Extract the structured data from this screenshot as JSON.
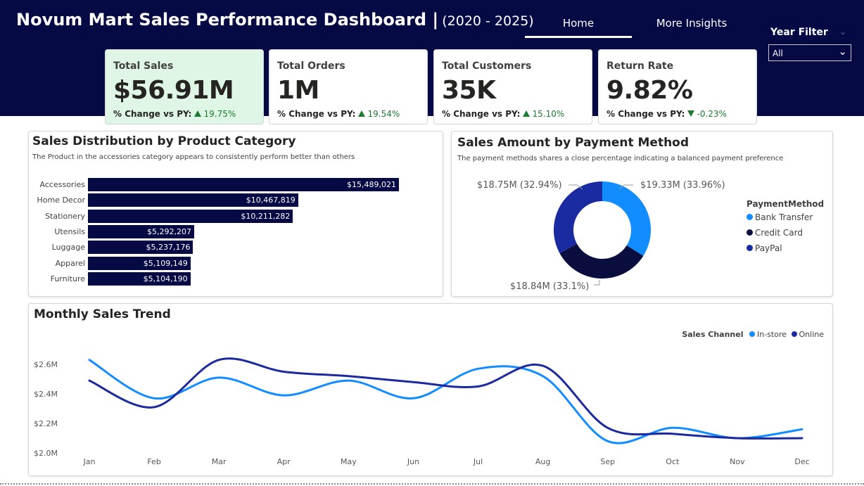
{
  "header": {
    "title": "Novum Mart Sales Performance Dashboard |",
    "subtitle": "(2020 - 2025)",
    "tabs": [
      {
        "label": "Home"
      },
      {
        "label": "More Insights"
      }
    ],
    "year_filter": {
      "label": "Year Filter",
      "value": "All"
    }
  },
  "kpis": [
    {
      "title": "Total Sales",
      "value": "$56.91M",
      "change_label": "% Change vs PY:",
      "change_value": "19.75%",
      "direction": "up"
    },
    {
      "title": "Total Orders",
      "value": "1M",
      "change_label": "% Change vs PY:",
      "change_value": "19.54%",
      "direction": "up"
    },
    {
      "title": "Total Customers",
      "value": "35K",
      "change_label": "% Change vs PY:",
      "change_value": "15.10%",
      "direction": "up"
    },
    {
      "title": "Return Rate",
      "value": "9.82%",
      "change_label": "% Change vs PY:",
      "change_value": "-0.23%",
      "direction": "down"
    }
  ],
  "category_panel": {
    "title": "Sales Distribution by Product Category",
    "subtitle": "The Product in the accessories category appears to consistently perform better than others"
  },
  "payment_panel": {
    "title": "Sales Amount by Payment Method",
    "subtitle": "The payment methods shares a close percentage indicating a balanced payment preference",
    "legend_title": "PaymentMethod"
  },
  "trend_panel": {
    "title": "Monthly Sales Trend",
    "legend_title": "Sales Channel"
  },
  "colors": {
    "navy": "#050a45",
    "light_blue": "#118dff",
    "dark_navy": "#0a0e3f",
    "royal_blue": "#1a2aa0",
    "online_line": "#1c2a9e",
    "green": "#1b7a30"
  },
  "chart_data": [
    {
      "type": "bar",
      "orientation": "horizontal",
      "title": "Sales Distribution by Product Category",
      "categories": [
        "Accessories",
        "Home Decor",
        "Stationery",
        "Utensils",
        "Luggage",
        "Apparel",
        "Furniture"
      ],
      "values": [
        15489021,
        10467819,
        10211282,
        5292207,
        5237176,
        5109149,
        5104190
      ],
      "value_labels": [
        "$15,489,021",
        "$10,467,819",
        "$10,211,282",
        "$5,292,207",
        "$5,237,176",
        "$5,109,149",
        "$5,104,190"
      ],
      "xlim": [
        0,
        15489021
      ]
    },
    {
      "type": "pie",
      "donut": true,
      "title": "Sales Amount by Payment Method",
      "slices": [
        {
          "name": "Bank Transfer",
          "percent": 33.96,
          "label": "$19.33M (33.96%)",
          "color": "#118dff"
        },
        {
          "name": "Credit Card",
          "percent": 33.1,
          "label": "$18.84M (33.1%)",
          "color": "#0a0e3f"
        },
        {
          "name": "PayPal",
          "percent": 32.94,
          "label": "$18.75M (32.94%)",
          "color": "#1a2aa0"
        }
      ]
    },
    {
      "type": "line",
      "title": "Monthly Sales Trend",
      "categories": [
        "Jan",
        "Feb",
        "Mar",
        "Apr",
        "May",
        "Jun",
        "Jul",
        "Aug",
        "Sep",
        "Oct",
        "Nov",
        "Dec"
      ],
      "y_ticks": [
        "$2.0M",
        "$2.2M",
        "$2.4M",
        "$2.6M"
      ],
      "ylim": [
        2.0,
        2.6
      ],
      "series": [
        {
          "name": "In-store",
          "color": "#118dff",
          "values": [
            2.63,
            2.37,
            2.51,
            2.39,
            2.49,
            2.37,
            2.57,
            2.52,
            2.08,
            2.17,
            2.1,
            2.16
          ]
        },
        {
          "name": "Online",
          "color": "#1c2a9e",
          "values": [
            2.49,
            2.31,
            2.63,
            2.55,
            2.52,
            2.48,
            2.45,
            2.59,
            2.17,
            2.13,
            2.1,
            2.1
          ]
        }
      ]
    }
  ]
}
